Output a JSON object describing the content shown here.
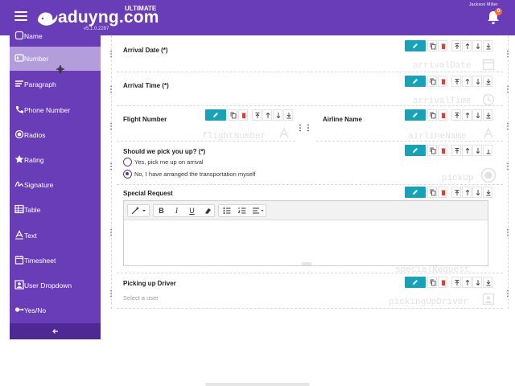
{
  "theme": {
    "primary": "#6a3db8",
    "accent": "#17a2b8",
    "danger": "#e53935"
  },
  "app": {
    "brand": "aduyng.com",
    "edition": "ULTIMATE",
    "version": "v5.1.0.2287",
    "user_name": "Jackson Miller",
    "notification_count": "0"
  },
  "sidebar": {
    "items": [
      {
        "label": "Name",
        "icon": "name-field-icon"
      },
      {
        "label": "Number",
        "icon": "number-field-icon"
      },
      {
        "label": "Paragraph",
        "icon": "paragraph-icon"
      },
      {
        "label": "Phone Number",
        "icon": "phone-icon"
      },
      {
        "label": "Radios",
        "icon": "radio-icon"
      },
      {
        "label": "Rating",
        "icon": "star-icon"
      },
      {
        "label": "Signature",
        "icon": "signature-icon"
      },
      {
        "label": "Table",
        "icon": "table-icon"
      },
      {
        "label": "Text",
        "icon": "text-icon"
      },
      {
        "label": "Timesheet",
        "icon": "timesheet-icon"
      },
      {
        "label": "User Dropdown",
        "icon": "user-dropdown-icon"
      },
      {
        "label": "Yes/No",
        "icon": "toggle-icon"
      }
    ],
    "active_index": 1
  },
  "form": {
    "fields": [
      {
        "label": "Arrival Date (*)",
        "ghost": "arrivalDate"
      },
      {
        "label": "Arrival Time (*)",
        "ghost": "arrivalTime"
      },
      {
        "label": "Flight Number",
        "ghost": "flightNumber"
      },
      {
        "label": "Airline Name",
        "ghost": "airlineName"
      },
      {
        "label": "Should we pick you up? (*)",
        "ghost": "pickUp"
      },
      {
        "label": "Special Request",
        "ghost": "specialRequest"
      },
      {
        "label": "Picking up Driver",
        "ghost": "pickingUpDriver"
      }
    ],
    "pickup_options": [
      {
        "label": "Yes, pick me up on arrival",
        "checked": false
      },
      {
        "label": "No, I have arranged the transportation myself",
        "checked": true
      }
    ],
    "driver_placeholder": "Select a user"
  },
  "editor": {
    "bold_label": "B",
    "italic_label": "I",
    "underline_label": "U"
  }
}
